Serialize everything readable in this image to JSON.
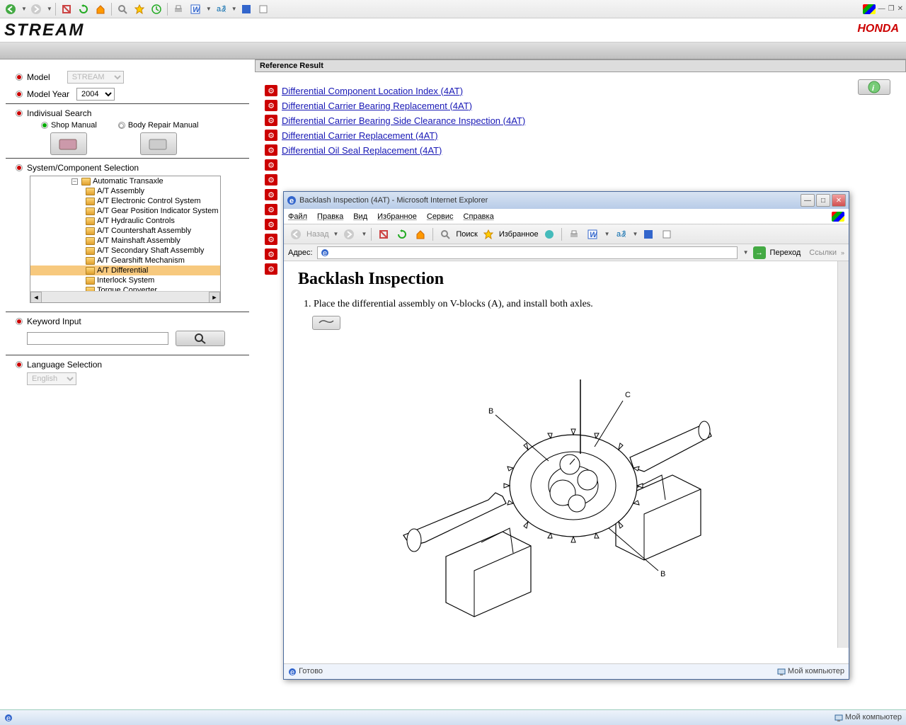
{
  "header": {
    "logo": "STREAM",
    "brand": "HONDA"
  },
  "sidebar": {
    "model_label": "Model",
    "model_value": "STREAM",
    "year_label": "Model Year",
    "year_value": "2004",
    "indiv_label": "Indivisual Search",
    "shop_label": "Shop Manual",
    "body_label": "Body Repair Manual",
    "comp_label": "System/Component Selection",
    "tree": {
      "root": "Automatic Transaxle",
      "items": [
        "A/T Assembly",
        "A/T Electronic Control System",
        "A/T Gear Position Indicator System",
        "A/T Hydraulic Controls",
        "A/T Countershaft Assembly",
        "A/T Mainshaft Assembly",
        "A/T Secondary Shaft Assembly",
        "A/T Gearshift Mechanism",
        "A/T Differential",
        "Interlock System",
        "Torque Converter"
      ],
      "selected": "A/T Differential"
    },
    "kw_label": "Keyword Input",
    "lang_label": "Language Selection",
    "lang_value": "English"
  },
  "main": {
    "title": "Reference Result",
    "links": [
      "Differential Component Location Index (4AT)",
      "Differential Carrier Bearing Replacement (4AT)",
      "Differential Carrier Bearing Side Clearance Inspection (4AT)",
      "Differential Carrier Replacement (4AT)",
      "Differential Oil Seal Replacement (4AT)"
    ]
  },
  "popup": {
    "title": "Backlash Inspection (4AT) - Microsoft Internet Explorer",
    "menu": [
      "Файл",
      "Правка",
      "Вид",
      "Избранное",
      "Сервис",
      "Справка"
    ],
    "tb": {
      "back": "Назад",
      "search": "Поиск",
      "fav": "Избранное"
    },
    "addr_label": "Адрес:",
    "go_label": "Переход",
    "links_label": "Ссылки",
    "body": {
      "h1": "Backlash Inspection",
      "step1": "1. Place the differential assembly on V-blocks (A), and install both axles.",
      "labels": {
        "b1": "B",
        "c": "C",
        "b2": "B"
      }
    },
    "status": {
      "left": "Готово",
      "right": "Мой компьютер"
    }
  },
  "taskbar": {
    "right": "Мой компьютер"
  },
  "winctrl": {
    "min": "—",
    "restore": "❐",
    "close": "✕"
  }
}
